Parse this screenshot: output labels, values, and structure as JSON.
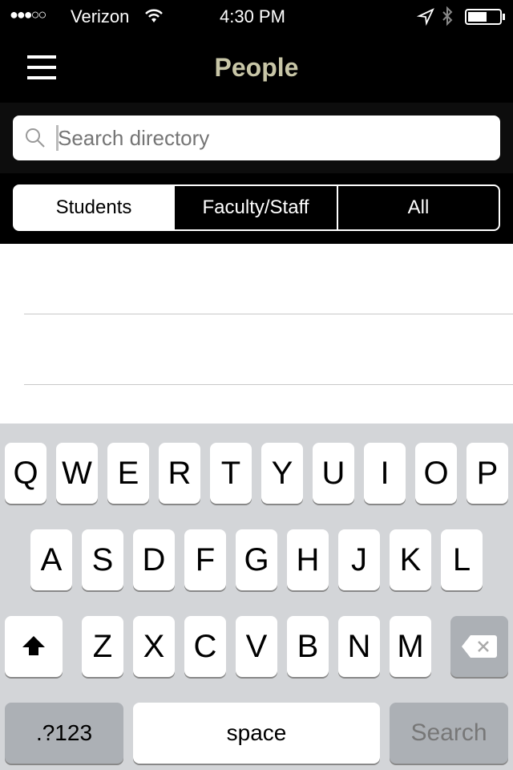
{
  "status": {
    "carrier": "Verizon",
    "signal_bars": 3,
    "time": "4:30 PM",
    "battery_percent": 60
  },
  "nav": {
    "title": "People",
    "title_color": "#c8c6a7",
    "menu_icon": "hamburger-icon"
  },
  "search": {
    "placeholder": "Search directory",
    "value": ""
  },
  "segments": [
    {
      "label": "Students",
      "selected": true
    },
    {
      "label": "Faculty/Staff",
      "selected": false
    },
    {
      "label": "All",
      "selected": false
    }
  ],
  "keyboard": {
    "row1": [
      "Q",
      "W",
      "E",
      "R",
      "T",
      "Y",
      "U",
      "I",
      "O",
      "P"
    ],
    "row2": [
      "A",
      "S",
      "D",
      "F",
      "G",
      "H",
      "J",
      "K",
      "L"
    ],
    "row3": [
      "Z",
      "X",
      "C",
      "V",
      "B",
      "N",
      "M"
    ],
    "numbers_label": ".?123",
    "space_label": "space",
    "search_label": "Search"
  }
}
